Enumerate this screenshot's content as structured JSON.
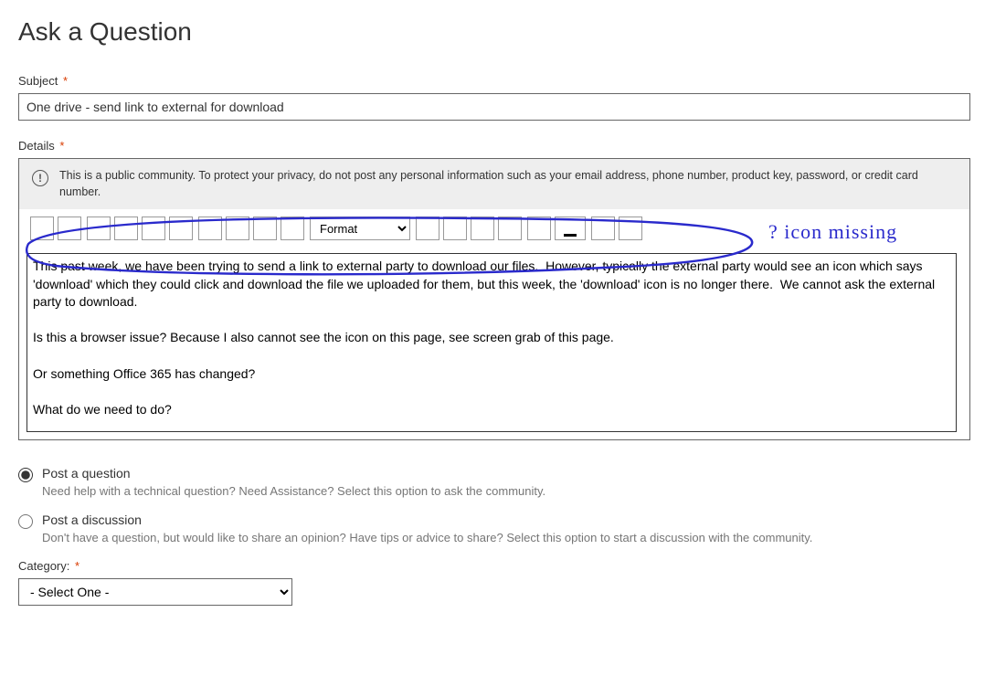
{
  "page_title": "Ask a Question",
  "subject": {
    "label": "Subject",
    "required_mark": "*",
    "value": "One drive - send link to external for download"
  },
  "details": {
    "label": "Details",
    "required_mark": "*",
    "privacy_notice": "This is a public community. To protect your privacy, do not post any personal information such as your email address, phone number, product key, password, or credit card number.",
    "format_dropdown_label": "Format",
    "body_text": "This past week, we have been trying to send a link to external party to download our files.  However, typically the external party would see an icon which says 'download' which they could click and download the file we uploaded for them, but this week, the 'download' icon is no longer there.  We cannot ask the external party to download.\n\nIs this a browser issue? Because I also cannot see the icon on this page, see screen grab of this page.\n\nOr something Office 365 has changed?\n\nWhat do we need to do?"
  },
  "annotation": {
    "hand_note": "? icon missing"
  },
  "post_type": {
    "options": [
      {
        "label": "Post a question",
        "description": "Need help with a technical question? Need Assistance? Select this option to ask the community.",
        "selected": true
      },
      {
        "label": "Post a discussion",
        "description": "Don't have a question, but would like to share an opinion? Have tips or advice to share? Select this option to start a discussion with the community.",
        "selected": false
      }
    ]
  },
  "category": {
    "label": "Category:",
    "required_mark": "*",
    "selected": "- Select One -"
  }
}
